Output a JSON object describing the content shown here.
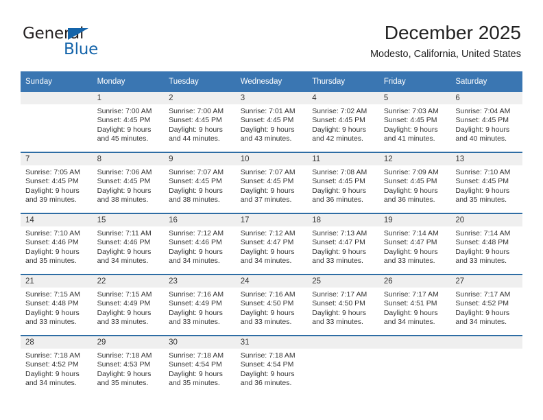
{
  "logo": {
    "word_one": "General",
    "word_two": "Blue",
    "triangle_icon": "blue-triangle-icon",
    "brand_color": "#1464aa"
  },
  "header": {
    "title": "December 2025",
    "subtitle": "Modesto, California, United States"
  },
  "calendar": {
    "accent_color": "#3a76b2",
    "separator_color": "#2e6da4",
    "daynum_band_color": "#efefef",
    "weekday_headers": [
      "Sunday",
      "Monday",
      "Tuesday",
      "Wednesday",
      "Thursday",
      "Friday",
      "Saturday"
    ],
    "weeks": [
      [
        {
          "day": "",
          "lines": []
        },
        {
          "day": "1",
          "lines": [
            "Sunrise: 7:00 AM",
            "Sunset: 4:45 PM",
            "Daylight: 9 hours",
            "and 45 minutes."
          ]
        },
        {
          "day": "2",
          "lines": [
            "Sunrise: 7:00 AM",
            "Sunset: 4:45 PM",
            "Daylight: 9 hours",
            "and 44 minutes."
          ]
        },
        {
          "day": "3",
          "lines": [
            "Sunrise: 7:01 AM",
            "Sunset: 4:45 PM",
            "Daylight: 9 hours",
            "and 43 minutes."
          ]
        },
        {
          "day": "4",
          "lines": [
            "Sunrise: 7:02 AM",
            "Sunset: 4:45 PM",
            "Daylight: 9 hours",
            "and 42 minutes."
          ]
        },
        {
          "day": "5",
          "lines": [
            "Sunrise: 7:03 AM",
            "Sunset: 4:45 PM",
            "Daylight: 9 hours",
            "and 41 minutes."
          ]
        },
        {
          "day": "6",
          "lines": [
            "Sunrise: 7:04 AM",
            "Sunset: 4:45 PM",
            "Daylight: 9 hours",
            "and 40 minutes."
          ]
        }
      ],
      [
        {
          "day": "7",
          "lines": [
            "Sunrise: 7:05 AM",
            "Sunset: 4:45 PM",
            "Daylight: 9 hours",
            "and 39 minutes."
          ]
        },
        {
          "day": "8",
          "lines": [
            "Sunrise: 7:06 AM",
            "Sunset: 4:45 PM",
            "Daylight: 9 hours",
            "and 38 minutes."
          ]
        },
        {
          "day": "9",
          "lines": [
            "Sunrise: 7:07 AM",
            "Sunset: 4:45 PM",
            "Daylight: 9 hours",
            "and 38 minutes."
          ]
        },
        {
          "day": "10",
          "lines": [
            "Sunrise: 7:07 AM",
            "Sunset: 4:45 PM",
            "Daylight: 9 hours",
            "and 37 minutes."
          ]
        },
        {
          "day": "11",
          "lines": [
            "Sunrise: 7:08 AM",
            "Sunset: 4:45 PM",
            "Daylight: 9 hours",
            "and 36 minutes."
          ]
        },
        {
          "day": "12",
          "lines": [
            "Sunrise: 7:09 AM",
            "Sunset: 4:45 PM",
            "Daylight: 9 hours",
            "and 36 minutes."
          ]
        },
        {
          "day": "13",
          "lines": [
            "Sunrise: 7:10 AM",
            "Sunset: 4:45 PM",
            "Daylight: 9 hours",
            "and 35 minutes."
          ]
        }
      ],
      [
        {
          "day": "14",
          "lines": [
            "Sunrise: 7:10 AM",
            "Sunset: 4:46 PM",
            "Daylight: 9 hours",
            "and 35 minutes."
          ]
        },
        {
          "day": "15",
          "lines": [
            "Sunrise: 7:11 AM",
            "Sunset: 4:46 PM",
            "Daylight: 9 hours",
            "and 34 minutes."
          ]
        },
        {
          "day": "16",
          "lines": [
            "Sunrise: 7:12 AM",
            "Sunset: 4:46 PM",
            "Daylight: 9 hours",
            "and 34 minutes."
          ]
        },
        {
          "day": "17",
          "lines": [
            "Sunrise: 7:12 AM",
            "Sunset: 4:47 PM",
            "Daylight: 9 hours",
            "and 34 minutes."
          ]
        },
        {
          "day": "18",
          "lines": [
            "Sunrise: 7:13 AM",
            "Sunset: 4:47 PM",
            "Daylight: 9 hours",
            "and 33 minutes."
          ]
        },
        {
          "day": "19",
          "lines": [
            "Sunrise: 7:14 AM",
            "Sunset: 4:47 PM",
            "Daylight: 9 hours",
            "and 33 minutes."
          ]
        },
        {
          "day": "20",
          "lines": [
            "Sunrise: 7:14 AM",
            "Sunset: 4:48 PM",
            "Daylight: 9 hours",
            "and 33 minutes."
          ]
        }
      ],
      [
        {
          "day": "21",
          "lines": [
            "Sunrise: 7:15 AM",
            "Sunset: 4:48 PM",
            "Daylight: 9 hours",
            "and 33 minutes."
          ]
        },
        {
          "day": "22",
          "lines": [
            "Sunrise: 7:15 AM",
            "Sunset: 4:49 PM",
            "Daylight: 9 hours",
            "and 33 minutes."
          ]
        },
        {
          "day": "23",
          "lines": [
            "Sunrise: 7:16 AM",
            "Sunset: 4:49 PM",
            "Daylight: 9 hours",
            "and 33 minutes."
          ]
        },
        {
          "day": "24",
          "lines": [
            "Sunrise: 7:16 AM",
            "Sunset: 4:50 PM",
            "Daylight: 9 hours",
            "and 33 minutes."
          ]
        },
        {
          "day": "25",
          "lines": [
            "Sunrise: 7:17 AM",
            "Sunset: 4:50 PM",
            "Daylight: 9 hours",
            "and 33 minutes."
          ]
        },
        {
          "day": "26",
          "lines": [
            "Sunrise: 7:17 AM",
            "Sunset: 4:51 PM",
            "Daylight: 9 hours",
            "and 34 minutes."
          ]
        },
        {
          "day": "27",
          "lines": [
            "Sunrise: 7:17 AM",
            "Sunset: 4:52 PM",
            "Daylight: 9 hours",
            "and 34 minutes."
          ]
        }
      ],
      [
        {
          "day": "28",
          "lines": [
            "Sunrise: 7:18 AM",
            "Sunset: 4:52 PM",
            "Daylight: 9 hours",
            "and 34 minutes."
          ]
        },
        {
          "day": "29",
          "lines": [
            "Sunrise: 7:18 AM",
            "Sunset: 4:53 PM",
            "Daylight: 9 hours",
            "and 35 minutes."
          ]
        },
        {
          "day": "30",
          "lines": [
            "Sunrise: 7:18 AM",
            "Sunset: 4:54 PM",
            "Daylight: 9 hours",
            "and 35 minutes."
          ]
        },
        {
          "day": "31",
          "lines": [
            "Sunrise: 7:18 AM",
            "Sunset: 4:54 PM",
            "Daylight: 9 hours",
            "and 36 minutes."
          ]
        },
        {
          "day": "",
          "lines": []
        },
        {
          "day": "",
          "lines": []
        },
        {
          "day": "",
          "lines": []
        }
      ]
    ]
  }
}
